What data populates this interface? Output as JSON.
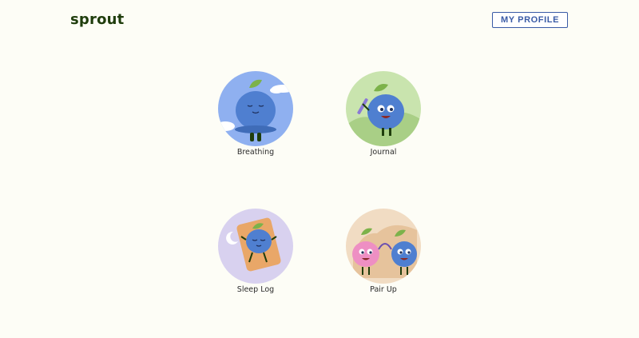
{
  "header": {
    "logo_text": "sprout",
    "profile_button": "MY PROFILE"
  },
  "activities": [
    {
      "label": "Breathing",
      "icon": "meditating-blueberry-icon",
      "bg": "#8fb0f0"
    },
    {
      "label": "Journal",
      "icon": "journaling-blueberry-icon",
      "bg": "#c9e4ae"
    },
    {
      "label": "Sleep Log",
      "icon": "sleeping-blueberry-icon",
      "bg": "#d8d1ef"
    },
    {
      "label": "Pair Up",
      "icon": "paired-berries-icon",
      "bg": "#f1dcc3"
    }
  ],
  "colors": {
    "background": "#fdfdf6",
    "brand_green": "#1f3d0c",
    "accent_blue": "#3a5ba6",
    "berry_blue": "#4f7fd0"
  }
}
